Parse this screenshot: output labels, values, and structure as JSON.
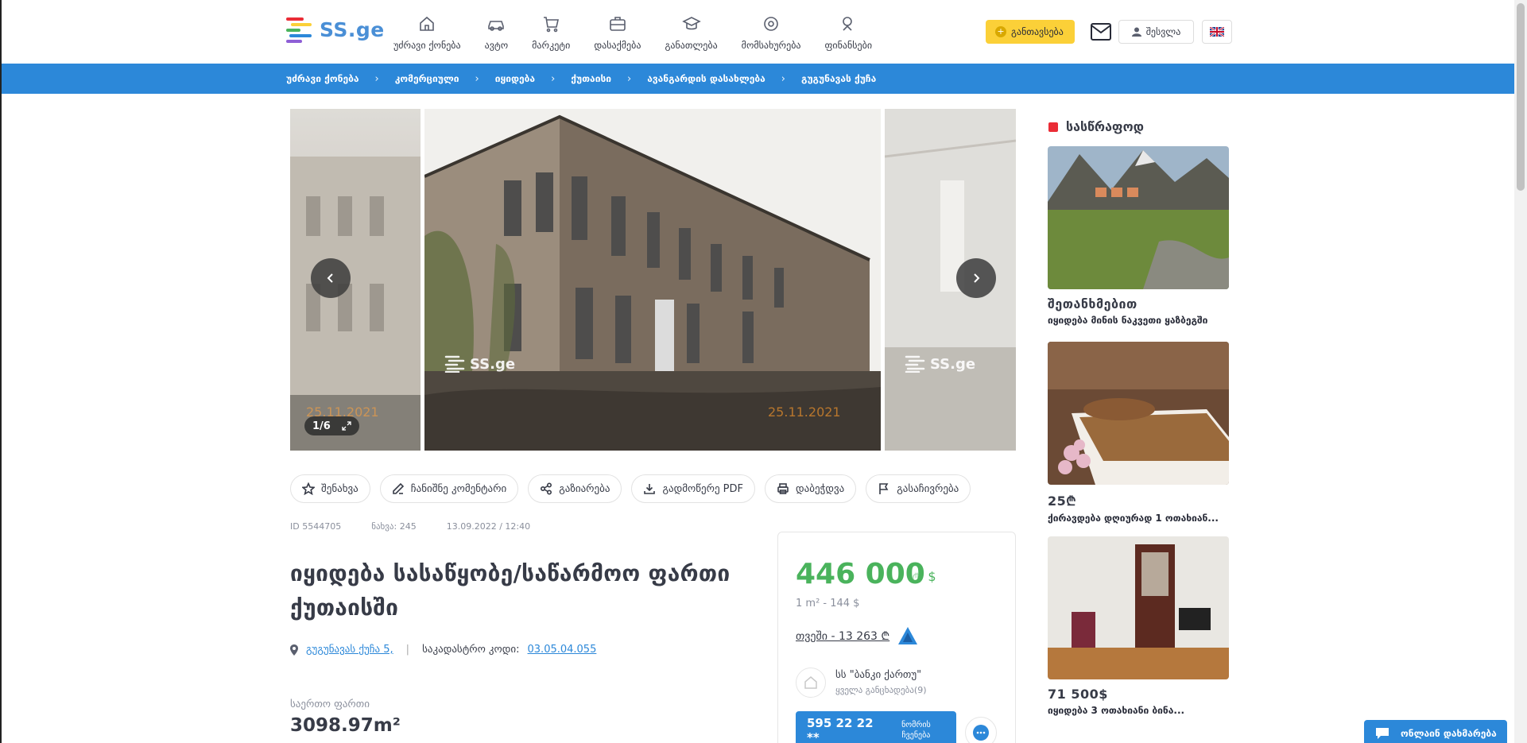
{
  "header": {
    "logo_text": "SS.ge",
    "nav": [
      {
        "label": "უძრავი ქონება",
        "icon": "home-icon"
      },
      {
        "label": "ავტო",
        "icon": "car-icon"
      },
      {
        "label": "მარკეტი",
        "icon": "cart-icon"
      },
      {
        "label": "დასაქმება",
        "icon": "briefcase-icon"
      },
      {
        "label": "განათლება",
        "icon": "graduation-icon"
      },
      {
        "label": "მომსახურება",
        "icon": "gear-icon"
      },
      {
        "label": "ფინანსები",
        "icon": "finance-icon"
      }
    ],
    "add_button": "განთავსება",
    "login_button": "შესვლა"
  },
  "breadcrumb": [
    "უძრავი ქონება",
    "კომერციული",
    "იყიდება",
    "ქუთაისი",
    "ავანგარდის დასახლება",
    "გუგუნავას ქუჩა"
  ],
  "gallery": {
    "counter": "1/6",
    "watermark": "SS.ge",
    "date_stamp": "25.11.2021"
  },
  "actions": [
    {
      "label": "შენახვა",
      "icon": "star-icon"
    },
    {
      "label": "ჩანიშნე კომენტარი",
      "icon": "edit-icon"
    },
    {
      "label": "გაზიარება",
      "icon": "share-icon"
    },
    {
      "label": "გადმოწერე PDF",
      "icon": "download-icon"
    },
    {
      "label": "დაბეჭდვა",
      "icon": "print-icon"
    },
    {
      "label": "გასაჩივრება",
      "icon": "flag-icon"
    }
  ],
  "meta": {
    "id": "ID 5544705",
    "views": "ნახვა: 245",
    "date": "13.09.2022 / 12:40"
  },
  "listing": {
    "title": "იყიდება სასაწყობე/საწარმოო ფართი ქუთაისში",
    "address": "გუგუნავას ქუჩა 5,",
    "cadastral_label": "საკადასტრო კოდი:",
    "cadastral_code": "03.05.04.055",
    "area_label": "საერთო ფართი",
    "area_value": "3098.97m²"
  },
  "price_card": {
    "price": "446 000",
    "currency_gel": "₾",
    "currency_usd": "$",
    "per_sqm": "1 m² - 144 $",
    "monthly": "თვეში - 13 263 ₾",
    "seller_name": "სს \"ბანკი ქართუ\"",
    "seller_all": "ყველა განცხადება(9)",
    "phone": "595 22 22 **",
    "show_number": "ნომრის ჩვენება"
  },
  "urgent": {
    "heading": "სასწრაფოდ",
    "cards": [
      {
        "price": "შეთანხმებით",
        "desc": "იყიდება მინის ნაკვეთი ყაზბეგში"
      },
      {
        "price": "25₾",
        "desc": "ქირავდება დღიურად 1 ოთახიან..."
      },
      {
        "price": "71 500$",
        "desc": "იყიდება 3 ოთახიანი ბინა..."
      }
    ]
  },
  "online_help": "ონლაინ დახმარება",
  "colors": {
    "primary": "#2c88d9",
    "price_green": "#4ab35c",
    "accent_yellow": "#fbd038",
    "urgent_red": "#ea2c36"
  }
}
